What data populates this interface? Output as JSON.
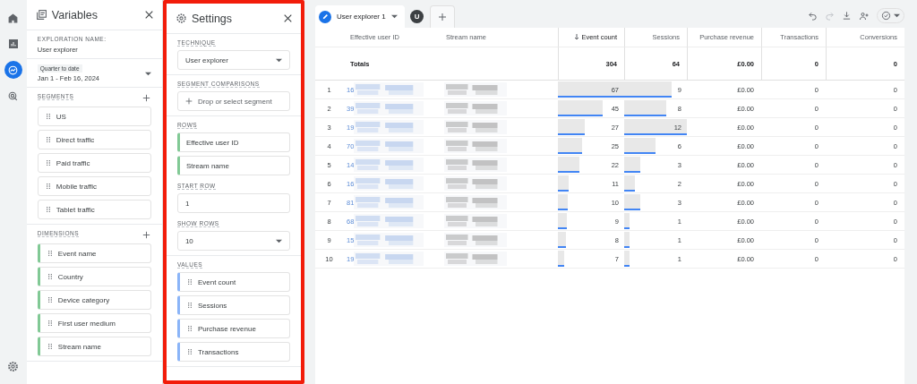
{
  "variables_panel": {
    "title": "Variables",
    "exploration_name_label": "EXPLORATION NAME:",
    "exploration_name": "User explorer",
    "date_range": {
      "label": "Quarter to date",
      "value": "Jan 1 - Feb 16, 2024"
    },
    "segments": {
      "heading": "SEGMENTS",
      "items": [
        "US",
        "Direct traffic",
        "Paid traffic",
        "Mobile traffic",
        "Tablet traffic"
      ]
    },
    "dimensions": {
      "heading": "DIMENSIONS",
      "items": [
        "Event name",
        "Country",
        "Device category",
        "First user medium",
        "Stream name"
      ]
    }
  },
  "settings_panel": {
    "title": "Settings",
    "highlighted": true,
    "technique": {
      "heading": "TECHNIQUE",
      "value": "User explorer"
    },
    "segment_comparisons": {
      "heading": "SEGMENT COMPARISONS",
      "placeholder": "Drop or select segment"
    },
    "rows": {
      "heading": "ROWS",
      "items": [
        "Effective user ID",
        "Stream name"
      ]
    },
    "start_row": {
      "heading": "START ROW",
      "value": "1"
    },
    "show_rows": {
      "heading": "SHOW ROWS",
      "value": "10"
    },
    "values": {
      "heading": "VALUES",
      "items": [
        "Event count",
        "Sessions",
        "Purchase revenue",
        "Transactions"
      ]
    }
  },
  "tabs": [
    {
      "label": "User explorer 1",
      "selected": true
    }
  ],
  "user_badge": "U",
  "table": {
    "columns": [
      "Effective user ID",
      "Stream name",
      "Event count",
      "Sessions",
      "Purchase revenue",
      "Transactions",
      "Conversions"
    ],
    "totals": {
      "label": "Totals",
      "values": [
        "304",
        "64",
        "£0.00",
        "0",
        "0"
      ]
    },
    "rows": [
      {
        "index": "1",
        "user_id": "16",
        "event_count": {
          "value": "67",
          "level": 1.0
        },
        "sessions": {
          "value": "9",
          "level": 0.75
        },
        "revenue": "£0.00",
        "transactions": "0",
        "conversions": "0"
      },
      {
        "index": "2",
        "user_id": "39",
        "event_count": {
          "value": "45",
          "level": 0.67
        },
        "sessions": {
          "value": "8",
          "level": 0.67
        },
        "revenue": "£0.00",
        "transactions": "0",
        "conversions": "0"
      },
      {
        "index": "3",
        "user_id": "19",
        "event_count": {
          "value": "27",
          "level": 0.4
        },
        "sessions": {
          "value": "12",
          "level": 1.0
        },
        "revenue": "£0.00",
        "transactions": "0",
        "conversions": "0"
      },
      {
        "index": "4",
        "user_id": "70",
        "event_count": {
          "value": "25",
          "level": 0.37
        },
        "sessions": {
          "value": "6",
          "level": 0.5
        },
        "revenue": "£0.00",
        "transactions": "0",
        "conversions": "0"
      },
      {
        "index": "5",
        "user_id": "14",
        "event_count": {
          "value": "22",
          "level": 0.33
        },
        "sessions": {
          "value": "3",
          "level": 0.25
        },
        "revenue": "£0.00",
        "transactions": "0",
        "conversions": "0"
      },
      {
        "index": "6",
        "user_id": "16",
        "event_count": {
          "value": "11",
          "level": 0.16
        },
        "sessions": {
          "value": "2",
          "level": 0.17
        },
        "revenue": "£0.00",
        "transactions": "0",
        "conversions": "0"
      },
      {
        "index": "7",
        "user_id": "81",
        "event_count": {
          "value": "10",
          "level": 0.15
        },
        "sessions": {
          "value": "3",
          "level": 0.25
        },
        "revenue": "£0.00",
        "transactions": "0",
        "conversions": "0"
      },
      {
        "index": "8",
        "user_id": "68",
        "event_count": {
          "value": "9",
          "level": 0.13
        },
        "sessions": {
          "value": "1",
          "level": 0.08
        },
        "revenue": "£0.00",
        "transactions": "0",
        "conversions": "0"
      },
      {
        "index": "9",
        "user_id": "15",
        "event_count": {
          "value": "8",
          "level": 0.12
        },
        "sessions": {
          "value": "1",
          "level": 0.08
        },
        "revenue": "£0.00",
        "transactions": "0",
        "conversions": "0"
      },
      {
        "index": "10",
        "user_id": "19",
        "event_count": {
          "value": "7",
          "level": 0.1
        },
        "sessions": {
          "value": "1",
          "level": 0.08
        },
        "revenue": "£0.00",
        "transactions": "0",
        "conversions": "0"
      }
    ]
  }
}
